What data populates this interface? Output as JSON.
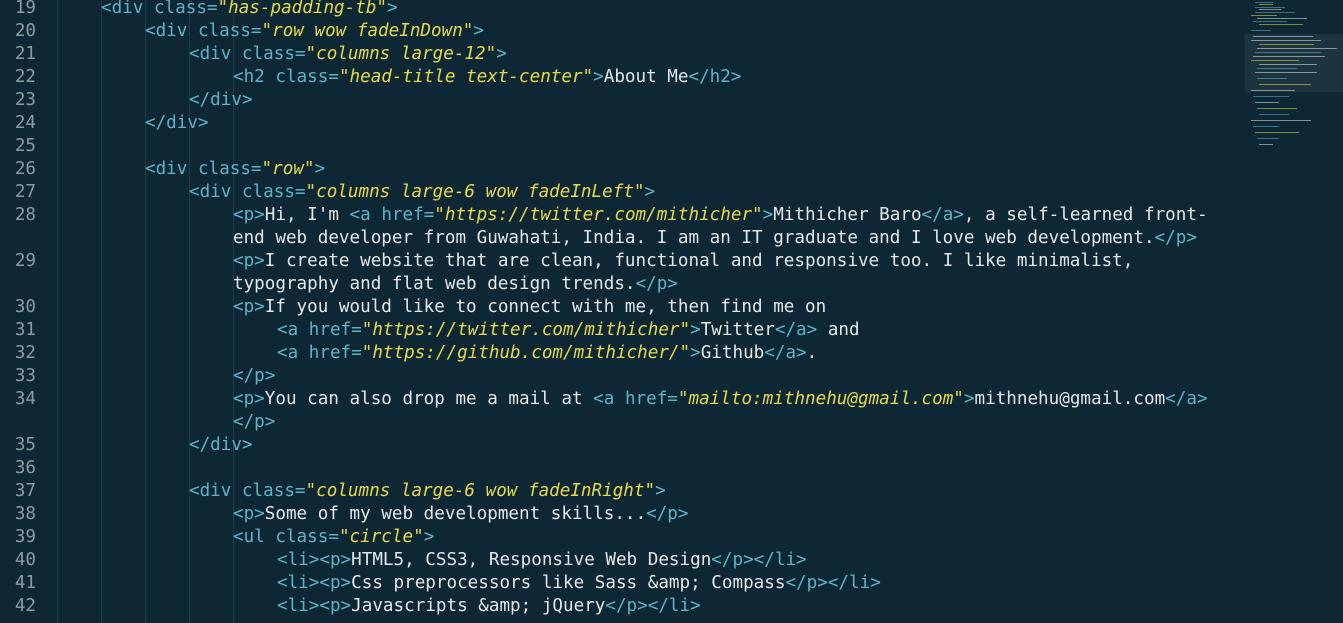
{
  "editor": {
    "lines": [
      {
        "num": "19",
        "indent": 1,
        "segments": [
          [
            "tag",
            "<div "
          ],
          [
            "attr",
            "class="
          ],
          [
            "str",
            "\"has-padding-tb\""
          ],
          [
            "tag",
            ">"
          ]
        ]
      },
      {
        "num": "20",
        "indent": 2,
        "segments": [
          [
            "tag",
            "<div "
          ],
          [
            "attr",
            "class="
          ],
          [
            "str",
            "\"row wow fadeInDown\""
          ],
          [
            "tag",
            ">"
          ]
        ]
      },
      {
        "num": "21",
        "indent": 3,
        "segments": [
          [
            "tag",
            "<div "
          ],
          [
            "attr",
            "class="
          ],
          [
            "str",
            "\"columns large-12\""
          ],
          [
            "tag",
            ">"
          ]
        ]
      },
      {
        "num": "22",
        "indent": 4,
        "segments": [
          [
            "tag",
            "<h2 "
          ],
          [
            "attr",
            "class="
          ],
          [
            "str",
            "\"head-title text-center\""
          ],
          [
            "tag",
            ">"
          ],
          [
            "t",
            "About Me"
          ],
          [
            "tag",
            "</h2>"
          ]
        ]
      },
      {
        "num": "23",
        "indent": 3,
        "segments": [
          [
            "tag",
            "</div>"
          ]
        ]
      },
      {
        "num": "24",
        "indent": 2,
        "segments": [
          [
            "tag",
            "</div>"
          ]
        ]
      },
      {
        "num": "25",
        "indent": 0,
        "segments": []
      },
      {
        "num": "26",
        "indent": 2,
        "segments": [
          [
            "tag",
            "<div "
          ],
          [
            "attr",
            "class="
          ],
          [
            "str",
            "\"row\""
          ],
          [
            "tag",
            ">"
          ]
        ]
      },
      {
        "num": "27",
        "indent": 3,
        "segments": [
          [
            "tag",
            "<div "
          ],
          [
            "attr",
            "class="
          ],
          [
            "str",
            "\"columns large-6 wow fadeInLeft\""
          ],
          [
            "tag",
            ">"
          ]
        ]
      },
      {
        "num": "28",
        "indent": 4,
        "segments": [
          [
            "tag",
            "<p>"
          ],
          [
            "t",
            "Hi, I'm "
          ],
          [
            "tag",
            "<a "
          ],
          [
            "attr",
            "href="
          ],
          [
            "str",
            "\"https://twitter.com/mithicher\""
          ],
          [
            "tag",
            ">"
          ],
          [
            "t",
            "Mithicher Baro"
          ],
          [
            "tag",
            "</a>"
          ],
          [
            "t",
            ", a self-learned front-"
          ]
        ]
      },
      {
        "num": "",
        "indent": 4,
        "segments": [
          [
            "t",
            "end web developer from Guwahati, India. I am an IT graduate and I love web development."
          ],
          [
            "tag",
            "</p>"
          ]
        ]
      },
      {
        "num": "29",
        "indent": 4,
        "segments": [
          [
            "tag",
            "<p>"
          ],
          [
            "t",
            "I create website that are clean, functional and responsive too. I like minimalist,"
          ]
        ]
      },
      {
        "num": "",
        "indent": 4,
        "segments": [
          [
            "t",
            "typography and flat web design trends."
          ],
          [
            "tag",
            "</p>"
          ]
        ]
      },
      {
        "num": "30",
        "indent": 4,
        "segments": [
          [
            "tag",
            "<p>"
          ],
          [
            "t",
            "If you would like to connect with me, then find me on"
          ]
        ]
      },
      {
        "num": "31",
        "indent": 5,
        "segments": [
          [
            "tag",
            "<a "
          ],
          [
            "attr",
            "href="
          ],
          [
            "str",
            "\"https://twitter.com/mithicher\""
          ],
          [
            "tag",
            ">"
          ],
          [
            "t",
            "Twitter"
          ],
          [
            "tag",
            "</a>"
          ],
          [
            "t",
            " and"
          ]
        ]
      },
      {
        "num": "32",
        "indent": 5,
        "segments": [
          [
            "tag",
            "<a "
          ],
          [
            "attr",
            "href="
          ],
          [
            "str",
            "\"https://github.com/mithicher/\""
          ],
          [
            "tag",
            ">"
          ],
          [
            "t",
            "Github"
          ],
          [
            "tag",
            "</a>"
          ],
          [
            "t",
            "."
          ]
        ]
      },
      {
        "num": "33",
        "indent": 4,
        "segments": [
          [
            "tag",
            "</p>"
          ]
        ]
      },
      {
        "num": "34",
        "indent": 4,
        "segments": [
          [
            "tag",
            "<p>"
          ],
          [
            "t",
            "You can also drop me a mail at "
          ],
          [
            "tag",
            "<a "
          ],
          [
            "attr",
            "href="
          ],
          [
            "str",
            "\"mailto:mithnehu@gmail.com\""
          ],
          [
            "tag",
            ">"
          ],
          [
            "t",
            "mithnehu@gmail.com"
          ],
          [
            "tag",
            "</a>"
          ]
        ]
      },
      {
        "num": "",
        "indent": 4,
        "segments": [
          [
            "tag",
            "</p>"
          ]
        ]
      },
      {
        "num": "35",
        "indent": 3,
        "segments": [
          [
            "tag",
            "</div>"
          ]
        ]
      },
      {
        "num": "36",
        "indent": 0,
        "segments": []
      },
      {
        "num": "37",
        "indent": 3,
        "segments": [
          [
            "tag",
            "<div "
          ],
          [
            "attr",
            "class="
          ],
          [
            "str",
            "\"columns large-6 wow fadeInRight\""
          ],
          [
            "tag",
            ">"
          ]
        ]
      },
      {
        "num": "38",
        "indent": 4,
        "segments": [
          [
            "tag",
            "<p>"
          ],
          [
            "t",
            "Some of my web development skills..."
          ],
          [
            "tag",
            "</p>"
          ]
        ]
      },
      {
        "num": "39",
        "indent": 4,
        "segments": [
          [
            "tag",
            "<ul "
          ],
          [
            "attr",
            "class="
          ],
          [
            "str",
            "\"circle\""
          ],
          [
            "tag",
            ">"
          ]
        ]
      },
      {
        "num": "40",
        "indent": 5,
        "segments": [
          [
            "tag",
            "<li><p>"
          ],
          [
            "t",
            "HTML5, CSS3, Responsive Web Design"
          ],
          [
            "tag",
            "</p></li>"
          ]
        ]
      },
      {
        "num": "41",
        "indent": 5,
        "segments": [
          [
            "tag",
            "<li><p>"
          ],
          [
            "t",
            "Css preprocessors like Sass &amp; Compass"
          ],
          [
            "tag",
            "</p></li>"
          ]
        ]
      },
      {
        "num": "42",
        "indent": 5,
        "segments": [
          [
            "tag",
            "<li><p>"
          ],
          [
            "t",
            "Javascripts &amp; jQuery"
          ],
          [
            "tag",
            "</p></li>"
          ]
        ]
      }
    ]
  }
}
